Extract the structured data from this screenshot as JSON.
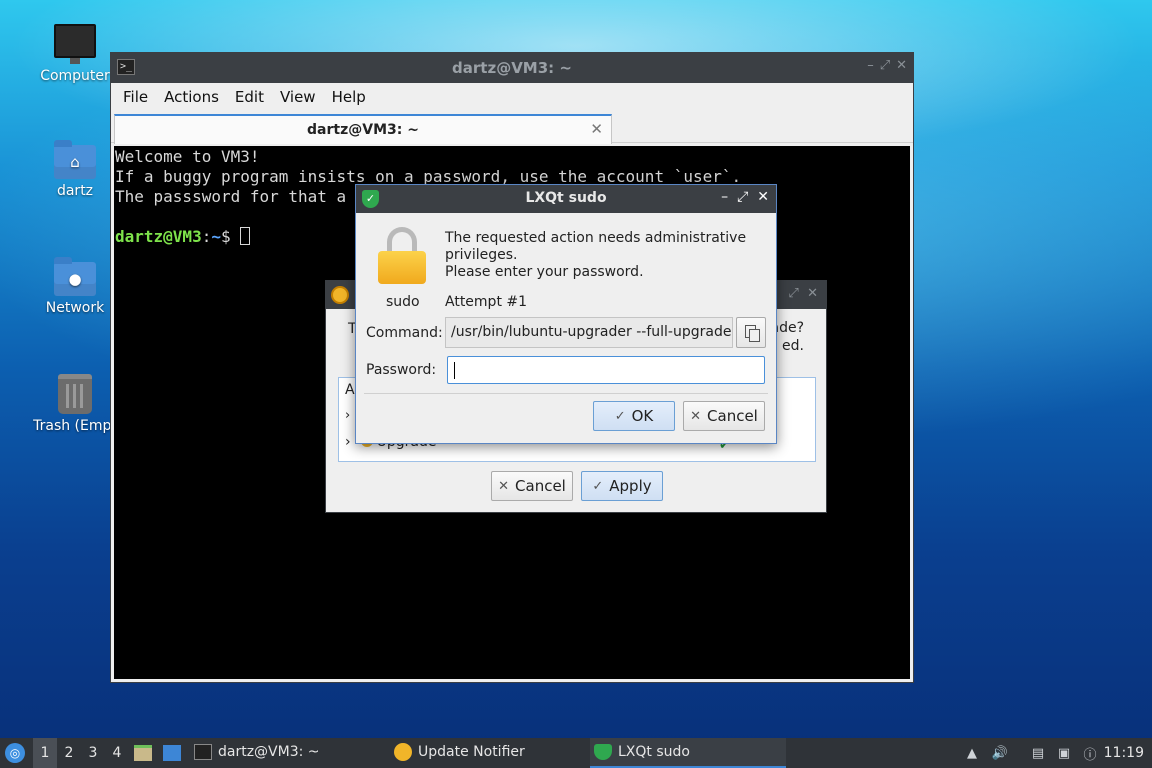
{
  "desktop": {
    "icons": [
      {
        "label": "Computer"
      },
      {
        "label": "dartz"
      },
      {
        "label": "Network"
      },
      {
        "label": "Trash (Empt"
      }
    ]
  },
  "terminal": {
    "title": "dartz@VM3: ~",
    "menu": [
      "File",
      "Actions",
      "Edit",
      "View",
      "Help"
    ],
    "tab_title": "dartz@VM3: ~",
    "tab_close": "✕",
    "lines": [
      "Welcome to VM3!",
      "If a buggy program insists on a password, use the account `user`.",
      "The passsword for that a"
    ],
    "prompt_user": "dartz@VM3",
    "prompt_sep": ":",
    "prompt_path": "~",
    "prompt_sym": "$ "
  },
  "update_notifier": {
    "text_left": "T",
    "text_right_1": "ade?",
    "text_right_2": "ed.",
    "tree_header": "A",
    "tree_row": "Upgrade",
    "cancel_label": "Cancel",
    "apply_label": "Apply"
  },
  "sudo": {
    "title": "LXQt sudo",
    "message_1": "The requested action needs administrative",
    "message_2": "privileges.",
    "message_3": "Please enter your password.",
    "user": "sudo",
    "attempt": "Attempt #1",
    "command_label": "Command:",
    "command": "/usr/bin/lubuntu-upgrader --full-upgrade",
    "password_label": "Password:",
    "password_value": "",
    "ok_label": "OK",
    "cancel_label": "Cancel",
    "accent": "#3d86d6"
  },
  "taskbar": {
    "desktops": [
      "1",
      "2",
      "3",
      "4"
    ],
    "active_desktop": "1",
    "tasks": [
      {
        "label": "dartz@VM3: ~"
      },
      {
        "label": "Update Notifier"
      },
      {
        "label": "LXQt sudo"
      }
    ],
    "clock": "11:19"
  }
}
